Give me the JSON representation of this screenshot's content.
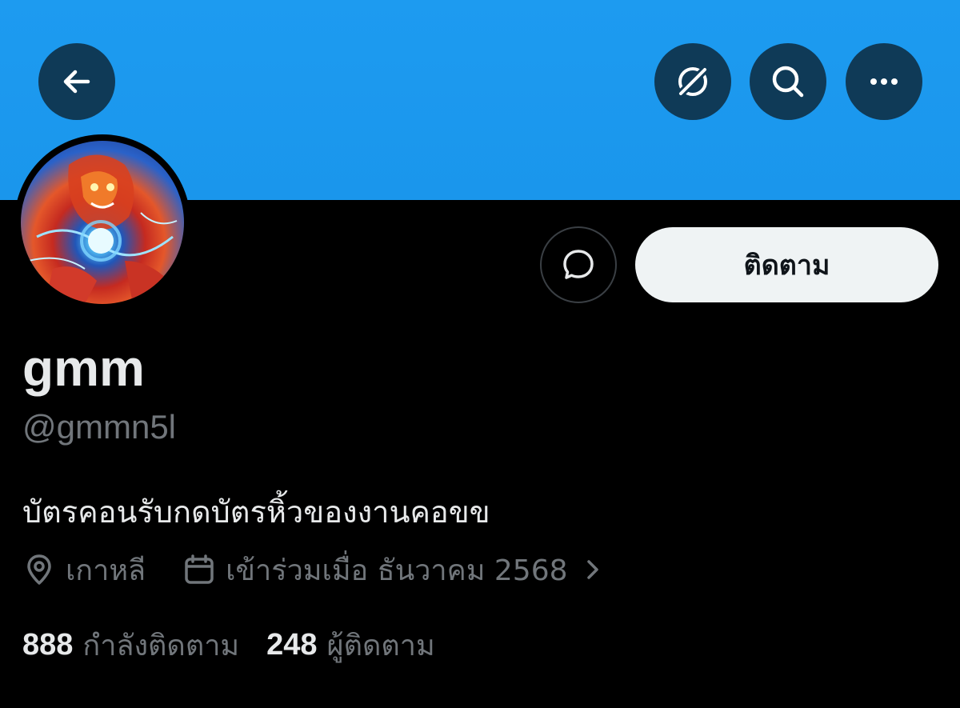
{
  "header": {
    "back_icon": "arrow-left-icon",
    "actions": [
      {
        "icon": "grok-slash-icon"
      },
      {
        "icon": "search-icon"
      },
      {
        "icon": "more-horizontal-icon"
      }
    ],
    "banner_color": "#1d9bf0"
  },
  "profile": {
    "display_name": "gmm",
    "handle": "@gmmn5l",
    "bio": "บัตรคอนรับกดบัตรหิ้วของงานคอขข",
    "location": "เกาหลี",
    "joined": "เข้าร่วมเมื่อ ธันวาคม 2568",
    "follow_label": "ติดตาม",
    "following_count": "888",
    "following_label": "กำลังติดตาม",
    "followers_count": "248",
    "followers_label": "ผู้ติดตาม"
  },
  "colors": {
    "background": "#000000",
    "primary_text": "#e7e9ea",
    "secondary_text": "#71767b",
    "button_bg": "#eff3f4",
    "header_button_bg": "#0f3a57"
  }
}
